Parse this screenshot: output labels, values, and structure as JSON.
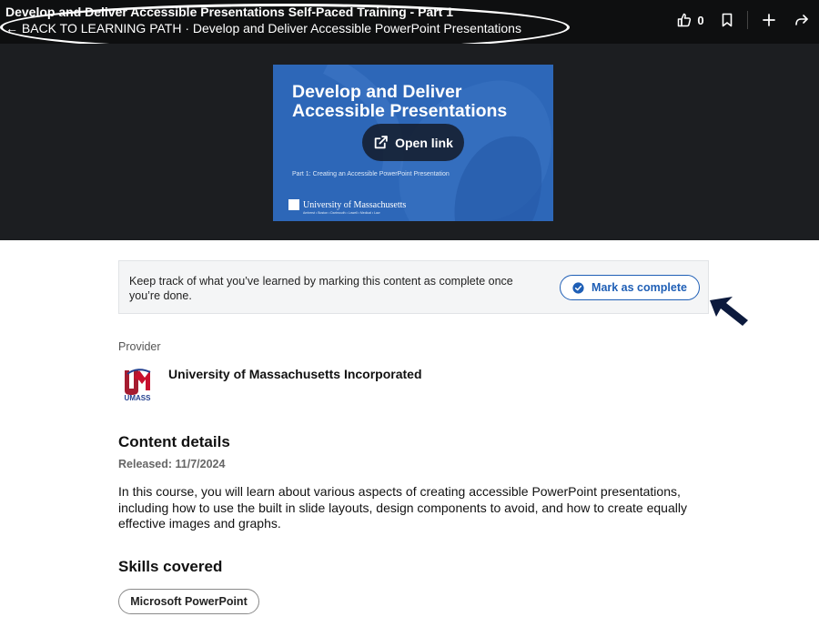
{
  "header": {
    "title": "Develop and Deliver Accessible Presentations Self-Paced Training - Part 1",
    "back_link": "← BACK TO LEARNING PATH · Develop and Deliver Accessible PowerPoint Presentations",
    "like_count": "0"
  },
  "hero": {
    "thumbnail_title": "Develop and Deliver Accessible Presentations",
    "thumbnail_subtitle": "Part 1: Creating an Accessible PowerPoint Presentation",
    "thumbnail_logo_text": "University of Massachusetts",
    "thumbnail_campuses": "Amherst • Boston • Dartmouth • Lowell • Medical • Law",
    "open_link_label": "Open link"
  },
  "notice": {
    "text": "Keep track of what you’ve learned by marking this content as complete once you’re done.",
    "button_label": "Mark as complete"
  },
  "provider": {
    "label": "Provider",
    "name": "University of Massachusetts Incorporated",
    "logo_text": "UMASS"
  },
  "content_details": {
    "heading": "Content details",
    "released": "Released: 11/7/2024",
    "description": "In this course, you will learn about various aspects of creating accessible PowerPoint presentations, including how to use the built in slide layouts, design components to avoid, and how to create equally effective images and graphs."
  },
  "skills": {
    "heading": "Skills covered",
    "items": [
      "Microsoft PowerPoint"
    ]
  },
  "colors": {
    "topbar_bg": "#0e0f10",
    "hero_bg": "#1c1e21",
    "accent_blue": "#1f5fb6",
    "thumbnail_blue": "#2d67b8",
    "arrow_navy": "#0c1a3d"
  }
}
